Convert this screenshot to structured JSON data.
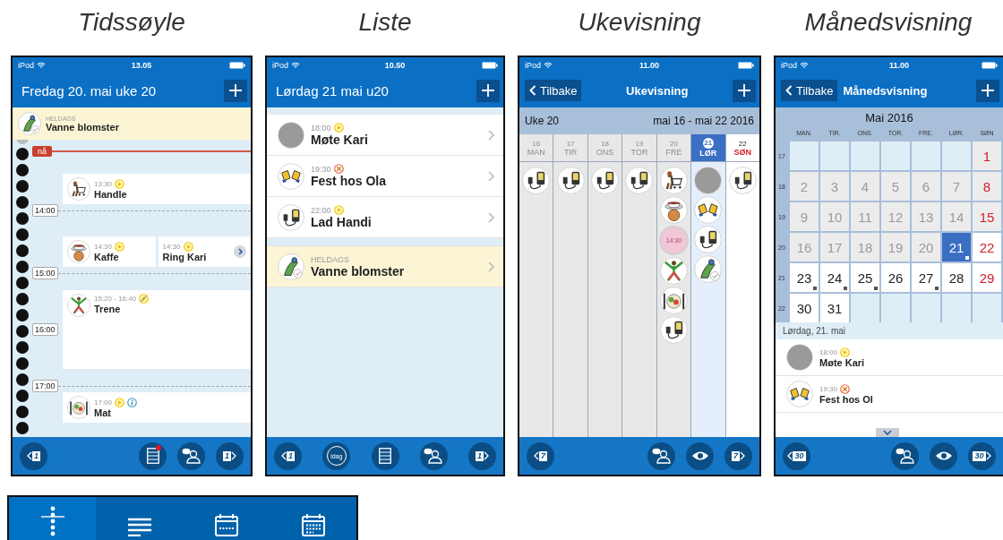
{
  "captions": [
    "Tidssøyle",
    "Liste",
    "Ukevisning",
    "Månedsvisning"
  ],
  "phones": [
    {
      "kind": "timeline",
      "status": {
        "carrier": "iPod",
        "time": "13.05"
      },
      "header": {
        "title": "Fredag 20. mai uke 20"
      },
      "allday": {
        "kind": "watering",
        "tag": "HELDAGS",
        "title": "Vanne blomster"
      },
      "timeline": [
        {
          "kind": "now",
          "label": "nå"
        },
        {
          "kind": "events",
          "events": [
            {
              "kind": "shopping",
              "time": "13:30",
              "title": "Handle",
              "badges": [
                {
                  "kind": "play"
                }
              ],
              "more": false
            }
          ]
        },
        {
          "kind": "hour",
          "label": "14:00"
        },
        {
          "kind": "events",
          "events": [
            {
              "kind": "coffee",
              "time": "14:30",
              "title": "Kaffe",
              "badges": [
                {
                  "kind": "play"
                }
              ],
              "more": false
            },
            {
              "kind": "none",
              "time": "14:30",
              "title": "Ring Kari",
              "badges": [
                {
                  "kind": "play"
                }
              ],
              "more": true
            }
          ]
        },
        {
          "kind": "hour",
          "label": "15:00"
        },
        {
          "kind": "events",
          "hour": "16:00",
          "events": [
            {
              "kind": "exercise",
              "time": "15:20 - 16:40",
              "title": "Trene",
              "badges": [
                {
                  "kind": "play-crossed"
                }
              ],
              "more": false
            }
          ]
        },
        {
          "kind": "hour",
          "label": "17:00"
        },
        {
          "kind": "events",
          "events": [
            {
              "kind": "meal",
              "time": "17:00",
              "title": "Mat",
              "badges": [
                {
                  "kind": "play"
                },
                {
                  "kind": "info"
                }
              ],
              "more": false
            }
          ]
        }
      ],
      "toolbar": [
        {
          "kind": "prev",
          "label": "1"
        },
        {
          "kind": "list",
          "notification": true
        },
        {
          "kind": "contacts"
        },
        {
          "kind": "next",
          "label": "1"
        }
      ]
    },
    {
      "kind": "list",
      "status": {
        "carrier": "iPod",
        "time": "10.50"
      },
      "header": {
        "title": "Lørdag 21 mai u20"
      },
      "rows": [
        {
          "kind": "photo",
          "time": "18:00",
          "title": "Møte Kari",
          "badges": [
            {
              "kind": "play"
            }
          ],
          "allday": false
        },
        {
          "kind": "cheers",
          "time": "19:30",
          "title": "Fest hos Ola",
          "badges": [
            {
              "kind": "cancelled"
            }
          ],
          "allday": false
        },
        {
          "kind": "charger",
          "time": "22:00",
          "title": "Lad Handi",
          "badges": [
            {
              "kind": "play"
            }
          ],
          "allday": false
        },
        {
          "kind": "watering",
          "tag": "HELDAGS",
          "title": "Vanne blomster",
          "allday": true
        }
      ],
      "toolbar": [
        {
          "kind": "prev",
          "label": "1"
        },
        {
          "kind": "today",
          "label": "idag"
        },
        {
          "kind": "list",
          "notification": false
        },
        {
          "kind": "contacts"
        },
        {
          "kind": "next",
          "label": "1"
        }
      ]
    },
    {
      "kind": "week",
      "status": {
        "carrier": "iPod",
        "time": "11.00"
      },
      "header": {
        "back": "Tilbake",
        "title": "Ukevisning"
      },
      "week": {
        "label": "Uke 20",
        "range": "mai 16 - mai 22 2016"
      },
      "days": [
        {
          "number": "16",
          "name": "MAN",
          "past": true,
          "selected": false,
          "holiday": false,
          "events": [
            {
              "kind": "charger"
            }
          ]
        },
        {
          "number": "17",
          "name": "TIR",
          "past": true,
          "selected": false,
          "holiday": false,
          "events": [
            {
              "kind": "charger"
            }
          ]
        },
        {
          "number": "18",
          "name": "ONS",
          "past": true,
          "selected": false,
          "holiday": false,
          "events": [
            {
              "kind": "charger"
            }
          ]
        },
        {
          "number": "19",
          "name": "TOR",
          "past": true,
          "selected": false,
          "holiday": false,
          "events": [
            {
              "kind": "charger"
            }
          ]
        },
        {
          "number": "20",
          "name": "FRE",
          "past": true,
          "selected": false,
          "holiday": false,
          "events": [
            {
              "kind": "shopping"
            },
            {
              "kind": "coffee"
            },
            {
              "kind": "time",
              "label": "14:30"
            },
            {
              "kind": "exercise"
            },
            {
              "kind": "meal"
            },
            {
              "kind": "charger"
            }
          ]
        },
        {
          "number": "21",
          "name": "LØR",
          "past": false,
          "selected": true,
          "holiday": false,
          "events": [
            {
              "kind": "photo"
            },
            {
              "kind": "cheers"
            },
            {
              "kind": "charger"
            },
            {
              "kind": "watering"
            }
          ]
        },
        {
          "number": "22",
          "name": "SØN",
          "past": false,
          "selected": false,
          "holiday": true,
          "events": [
            {
              "kind": "charger"
            }
          ]
        }
      ],
      "toolbar": [
        {
          "kind": "prev",
          "label": "7"
        },
        {
          "kind": "contacts"
        },
        {
          "kind": "eye"
        },
        {
          "kind": "next",
          "label": "7"
        }
      ]
    },
    {
      "kind": "month",
      "status": {
        "carrier": "iPod",
        "time": "11.00"
      },
      "header": {
        "back": "Tilbake",
        "title": "Månedsvisning"
      },
      "month": {
        "title": "Mai 2016",
        "weekdays": [
          "MAN.",
          "TIR.",
          "ONS.",
          "TOR.",
          "FRE.",
          "LØR.",
          "SØN"
        ],
        "weeks": [
          {
            "number": "17",
            "days": [
              {
                "kind": "blank"
              },
              {
                "kind": "blank"
              },
              {
                "kind": "blank"
              },
              {
                "kind": "blank"
              },
              {
                "kind": "blank"
              },
              {
                "kind": "blank"
              },
              {
                "kind": "day",
                "label": "1",
                "past": true,
                "holiday": true,
                "selected": false,
                "marker": false
              }
            ]
          },
          {
            "number": "18",
            "days": [
              {
                "kind": "day",
                "label": "2",
                "past": true,
                "holiday": false,
                "selected": false,
                "marker": false
              },
              {
                "kind": "day",
                "label": "3",
                "past": true,
                "holiday": false,
                "selected": false,
                "marker": false
              },
              {
                "kind": "day",
                "label": "4",
                "past": true,
                "holiday": false,
                "selected": false,
                "marker": false
              },
              {
                "kind": "day",
                "label": "5",
                "past": true,
                "holiday": false,
                "selected": false,
                "marker": false
              },
              {
                "kind": "day",
                "label": "6",
                "past": true,
                "holiday": false,
                "selected": false,
                "marker": false
              },
              {
                "kind": "day",
                "label": "7",
                "past": true,
                "holiday": false,
                "selected": false,
                "marker": false
              },
              {
                "kind": "day",
                "label": "8",
                "past": true,
                "holiday": true,
                "selected": false,
                "marker": false
              }
            ]
          },
          {
            "number": "19",
            "days": [
              {
                "kind": "day",
                "label": "9",
                "past": true,
                "holiday": false,
                "selected": false,
                "marker": false
              },
              {
                "kind": "day",
                "label": "10",
                "past": true,
                "holiday": false,
                "selected": false,
                "marker": false
              },
              {
                "kind": "day",
                "label": "11",
                "past": true,
                "holiday": false,
                "selected": false,
                "marker": false
              },
              {
                "kind": "day",
                "label": "12",
                "past": true,
                "holiday": false,
                "selected": false,
                "marker": false
              },
              {
                "kind": "day",
                "label": "13",
                "past": true,
                "holiday": false,
                "selected": false,
                "marker": false
              },
              {
                "kind": "day",
                "label": "14",
                "past": true,
                "holiday": false,
                "selected": false,
                "marker": false
              },
              {
                "kind": "day",
                "label": "15",
                "past": true,
                "holiday": true,
                "selected": false,
                "marker": false
              }
            ]
          },
          {
            "number": "20",
            "days": [
              {
                "kind": "day",
                "label": "16",
                "past": true,
                "holiday": false,
                "selected": false,
                "marker": false
              },
              {
                "kind": "day",
                "label": "17",
                "past": true,
                "holiday": false,
                "selected": false,
                "marker": false
              },
              {
                "kind": "day",
                "label": "18",
                "past": true,
                "holiday": false,
                "selected": false,
                "marker": false
              },
              {
                "kind": "day",
                "label": "19",
                "past": true,
                "holiday": false,
                "selected": false,
                "marker": false
              },
              {
                "kind": "day",
                "label": "20",
                "past": true,
                "holiday": false,
                "selected": false,
                "marker": false
              },
              {
                "kind": "day",
                "label": "21",
                "past": false,
                "holiday": false,
                "selected": true,
                "marker": true
              },
              {
                "kind": "day",
                "label": "22",
                "past": false,
                "holiday": true,
                "selected": false,
                "marker": false
              }
            ]
          },
          {
            "number": "21",
            "days": [
              {
                "kind": "day",
                "label": "23",
                "past": false,
                "holiday": false,
                "selected": false,
                "marker": true
              },
              {
                "kind": "day",
                "label": "24",
                "past": false,
                "holiday": false,
                "selected": false,
                "marker": true
              },
              {
                "kind": "day",
                "label": "25",
                "past": false,
                "holiday": false,
                "selected": false,
                "marker": true
              },
              {
                "kind": "day",
                "label": "26",
                "past": false,
                "holiday": false,
                "selected": false,
                "marker": false
              },
              {
                "kind": "day",
                "label": "27",
                "past": false,
                "holiday": false,
                "selected": false,
                "marker": true
              },
              {
                "kind": "day",
                "label": "28",
                "past": false,
                "holiday": false,
                "selected": false,
                "marker": false
              },
              {
                "kind": "day",
                "label": "29",
                "past": false,
                "holiday": true,
                "selected": false,
                "marker": false
              }
            ]
          },
          {
            "number": "22",
            "days": [
              {
                "kind": "day",
                "label": "30",
                "past": false,
                "holiday": false,
                "selected": false,
                "marker": false
              },
              {
                "kind": "day",
                "label": "31",
                "past": false,
                "holiday": false,
                "selected": false,
                "marker": false
              },
              {
                "kind": "blank"
              },
              {
                "kind": "blank"
              },
              {
                "kind": "blank"
              },
              {
                "kind": "blank"
              },
              {
                "kind": "blank"
              }
            ]
          }
        ]
      },
      "section": "Lørdag, 21. mai",
      "rows": [
        {
          "kind": "photo",
          "time": "18:00",
          "title": "Møte Kari",
          "badges": [
            {
              "kind": "play"
            }
          ]
        },
        {
          "kind": "cheers",
          "time": "19:30",
          "title": "Fest hos Ol",
          "badges": [
            {
              "kind": "cancelled"
            }
          ]
        }
      ],
      "toolbar": [
        {
          "kind": "prev",
          "label": "30"
        },
        {
          "kind": "contacts"
        },
        {
          "kind": "eye"
        },
        {
          "kind": "next",
          "label": "30"
        }
      ]
    }
  ],
  "view_tabs": [
    {
      "kind": "timeline",
      "selected": true
    },
    {
      "kind": "list",
      "selected": false
    },
    {
      "kind": "week",
      "selected": false
    },
    {
      "kind": "month",
      "selected": false
    }
  ]
}
